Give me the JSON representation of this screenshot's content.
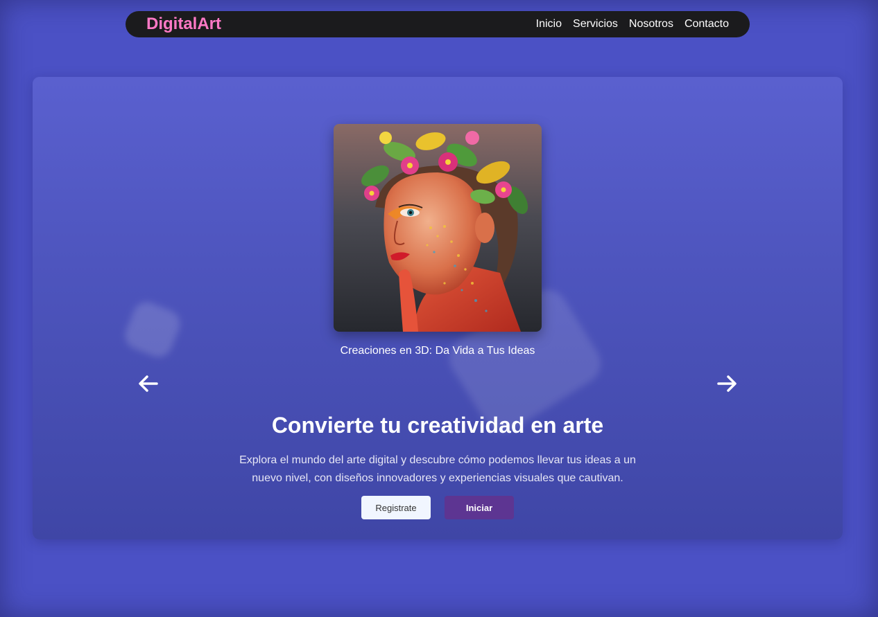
{
  "navbar": {
    "logo": "DigitalArt",
    "links": [
      "Inicio",
      "Servicios",
      "Nosotros",
      "Contacto"
    ]
  },
  "carousel": {
    "image_subject": "portrait-with-flower-crown",
    "caption": "Creaciones en 3D: Da Vida a Tus Ideas",
    "prev_icon": "arrow-left-icon",
    "next_icon": "arrow-right-icon"
  },
  "hero": {
    "title": "Convierte tu creatividad en arte",
    "description": "Explora el mundo del arte digital y descubre cómo podemos llevar tus ideas a un nuevo nivel, con diseños innovadores y experiencias visuales que cautivan.",
    "register_label": "Registrate",
    "start_label": "Iniciar"
  },
  "colors": {
    "page_background": "#4b51c5",
    "navbar_background": "#1b1b1d",
    "logo": "#ff79c6",
    "primary_button": "#5d3592",
    "secondary_button": "#f1f6ff"
  }
}
